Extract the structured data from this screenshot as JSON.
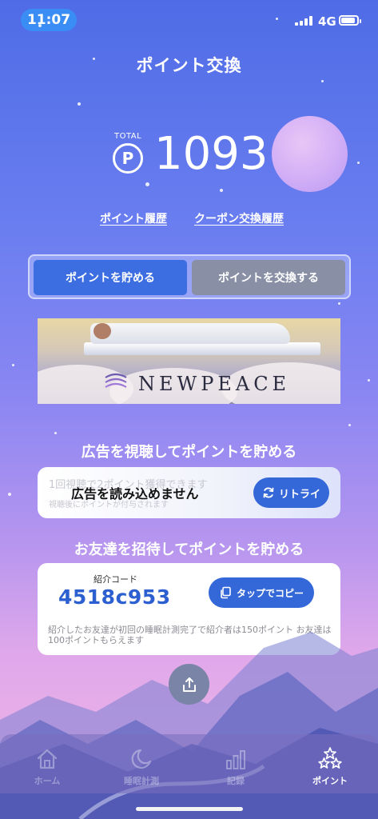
{
  "status_bar": {
    "time": "11:07",
    "network": "4G",
    "battery_level": 0.92
  },
  "header": {
    "title": "ポイント交換"
  },
  "points": {
    "total_label": "TOTAL",
    "currency_symbol": "P",
    "value": "1093"
  },
  "links": {
    "point_history": "ポイント履歴",
    "coupon_history": "クーポン交換履歴"
  },
  "tabs": [
    {
      "label": "ポイントを貯める",
      "active": true
    },
    {
      "label": "ポイントを交換する",
      "active": false
    }
  ],
  "ad_banner": {
    "brand": "NEWPEACE"
  },
  "watch_ad": {
    "section_title": "広告を視聴してポイントを貯める",
    "ghost_title": "1回視聴で2ポイント獲得できます",
    "ghost_sub": "視聴後にポイントが付与されます",
    "message": "広告を読み込めません",
    "retry_label": "リトライ"
  },
  "invite": {
    "section_title": "お友達を招待してポイントを貯める",
    "code_label": "紹介コード",
    "code": "4518c953",
    "copy_label": "タップでコピー",
    "note": "紹介したお友達が初回の睡眠計測完了で紹介者は150ポイント お友達は100ポイントもらえます"
  },
  "bottom_nav": [
    {
      "label": "ホーム",
      "icon": "home-icon",
      "active": false
    },
    {
      "label": "睡眠計測",
      "icon": "moon-icon",
      "active": false
    },
    {
      "label": "記録",
      "icon": "chart-icon",
      "active": false
    },
    {
      "label": "ポイント",
      "icon": "stars-icon",
      "active": true
    }
  ],
  "colors": {
    "primary": "#3468d8",
    "code": "#2c5fd0",
    "inactive_tab": "#8990a6"
  }
}
